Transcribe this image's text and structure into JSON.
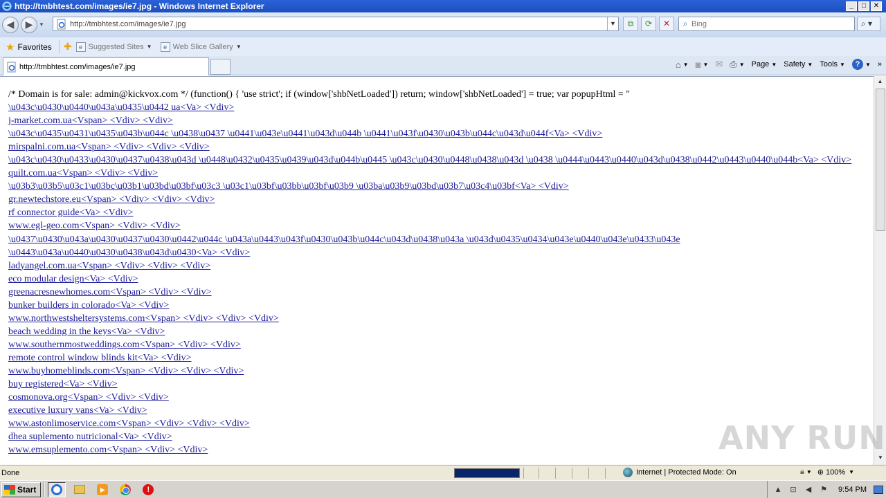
{
  "window": {
    "title": "http://tmbhtest.com/images/ie7.jpg - Windows Internet Explorer",
    "controls": {
      "minimize": "_",
      "maximize": "□",
      "close": "✕"
    }
  },
  "navbar": {
    "back_icon": "back-arrow-icon",
    "forward_icon": "forward-arrow-icon",
    "address_url": "http://tmbhtest.com/images/ie7.jpg",
    "search_placeholder": "Bing"
  },
  "favorites_bar": {
    "favorites_label": "Favorites",
    "links": [
      {
        "label": "Suggested Sites"
      },
      {
        "label": "Web Slice Gallery"
      }
    ]
  },
  "tabs": [
    {
      "label": "http://tmbhtest.com/images/ie7.jpg"
    }
  ],
  "command_bar": {
    "page_label": "Page",
    "safety_label": "Safety",
    "tools_label": "Tools"
  },
  "content": {
    "intro": "/* Domain is for sale: admin@kickvox.com */ (function() { 'use strict'; if (window['shbNetLoaded']) return; window['shbNetLoaded'] = true; var popupHtml = \"",
    "links": [
      "\\u043c\\u0430\\u0440\\u043a\\u0435\\u0442 ua<Va> <Vdiv>",
      "j-market.com.ua<Vspan> <Vdiv> <Vdiv>",
      "\\u043c\\u0435\\u0431\\u0435\\u043b\\u044c \\u0438\\u0437 \\u0441\\u043e\\u0441\\u043d\\u044b \\u0441\\u043f\\u0430\\u043b\\u044c\\u043d\\u044f<Va> <Vdiv>",
      "mirspalni.com.ua<Vspan> <Vdiv> <Vdiv> <Vdiv>",
      "\\u043c\\u0430\\u0433\\u0430\\u0437\\u0438\\u043d \\u0448\\u0432\\u0435\\u0439\\u043d\\u044b\\u0445 \\u043c\\u0430\\u0448\\u0438\\u043d \\u0438 \\u0444\\u0443\\u0440\\u043d\\u0438\\u0442\\u0443\\u0440\\u044b<Va> <Vdiv>",
      "quilt.com.ua<Vspan> <Vdiv> <Vdiv>",
      "\\u03b3\\u03b5\\u03c1\\u03bc\\u03b1\\u03bd\\u03bf\\u03c3 \\u03c1\\u03bf\\u03bb\\u03bf\\u03b9 \\u03ba\\u03b9\\u03bd\\u03b7\\u03c4\\u03bf<Va> <Vdiv>",
      "gr.newtechstore.eu<Vspan> <Vdiv> <Vdiv> <Vdiv>",
      "rf connector guide<Va> <Vdiv>",
      "www.egl-geo.com<Vspan> <Vdiv> <Vdiv>",
      "\\u0437\\u0430\\u043a\\u0430\\u0437\\u0430\\u0442\\u044c \\u043a\\u0443\\u043f\\u0430\\u043b\\u044c\\u043d\\u0438\\u043a \\u043d\\u0435\\u0434\\u043e\\u0440\\u043e\\u0433\\u043e \\u0443\\u043a\\u0440\\u0430\\u0438\\u043d\\u0430<Va> <Vdiv>",
      "ladyangel.com.ua<Vspan> <Vdiv> <Vdiv> <Vdiv>",
      "eco modular design<Va> <Vdiv>",
      "greenacresnewhomes.com<Vspan> <Vdiv> <Vdiv>",
      "bunker builders in colorado<Va> <Vdiv>",
      "www.northwestsheltersystems.com<Vspan> <Vdiv> <Vdiv> <Vdiv>",
      "beach wedding in the keys<Va> <Vdiv>",
      "www.southernmostweddings.com<Vspan> <Vdiv> <Vdiv>",
      "remote control window blinds kit<Va> <Vdiv>",
      "www.buyhomeblinds.com<Vspan> <Vdiv> <Vdiv> <Vdiv>",
      "buy registered<Va> <Vdiv>",
      "cosmonova.org<Vspan> <Vdiv> <Vdiv>",
      "executive luxury vans<Va> <Vdiv>",
      "www.astonlimoservice.com<Vspan> <Vdiv> <Vdiv> <Vdiv>",
      "dhea suplemento nutricional<Va> <Vdiv>",
      "www.emsuplemento.com<Vspan> <Vdiv> <Vdiv>"
    ]
  },
  "statusbar": {
    "status_text": "Done",
    "progress": 1.0,
    "zone_text": "Internet | Protected Mode: On",
    "zoom_text": "100%"
  },
  "watermark": "ANY RUN",
  "taskbar": {
    "start_label": "Start",
    "clock": "9:54 PM"
  }
}
